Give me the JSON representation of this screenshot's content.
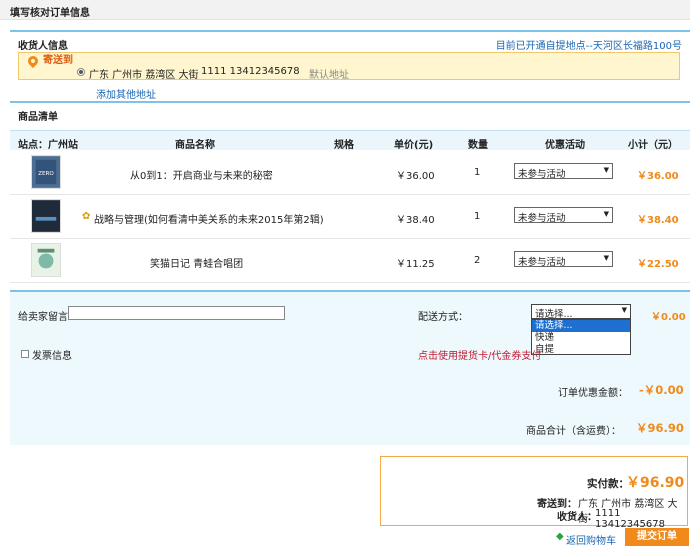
{
  "title": "填写核对订单信息",
  "receiver": {
    "heading": "收货人信息",
    "pickup_link": "目前已开通自提地点--天河区长福路100号",
    "ship_to": "寄送到",
    "address": "广东 广州市 荔湾区 大街",
    "phone": "1111 13412345678",
    "default_addr": "默认地址",
    "add_address": "添加其他地址"
  },
  "goods": {
    "heading": "商品清单",
    "columns": [
      "站点：广州站",
      "商品名称",
      "规格",
      "单价(元)",
      "数量",
      "优惠活动",
      "小计（元）"
    ],
    "rows": [
      {
        "name": "从0到1：开启商业与未来的秘密",
        "price": "￥36.00",
        "qty": "1",
        "promo": "未参与活动",
        "subtotal": "￥36.00"
      },
      {
        "name": "战略与管理(如何看清中美关系的未来2015年第2辑)",
        "price": "￥38.40",
        "qty": "1",
        "promo": "未参与活动",
        "subtotal": "￥38.40"
      },
      {
        "name": "笑猫日记 青蛙合唱团",
        "price": "￥11.25",
        "qty": "2",
        "promo": "未参与活动",
        "subtotal": "￥22.50"
      }
    ]
  },
  "footer": {
    "message_label": "给卖家留言",
    "invoice_label": "发票信息",
    "shipping_label": "配送方式：",
    "shipping_selected": "请选择...",
    "shipping_options": [
      "请选择...",
      "快递",
      "自提"
    ],
    "shipping_fee": "￥0.00",
    "card_link": "点击使用提货卡/代金券支付",
    "discount_label": "订单优惠金额：",
    "discount_value": "-￥0.00",
    "total_label": "商品合计（含运费）：",
    "total_value": "￥96.90"
  },
  "pay": {
    "label": "实付款：",
    "value": "￥96.90",
    "addr_label": "寄送到：",
    "addr_value": "广东 广州市 荔湾区 大街",
    "receiver_label": "收货人：",
    "receiver_value": "1111 13412345678",
    "back_link": "返回购物车",
    "submit": "提交订单"
  }
}
